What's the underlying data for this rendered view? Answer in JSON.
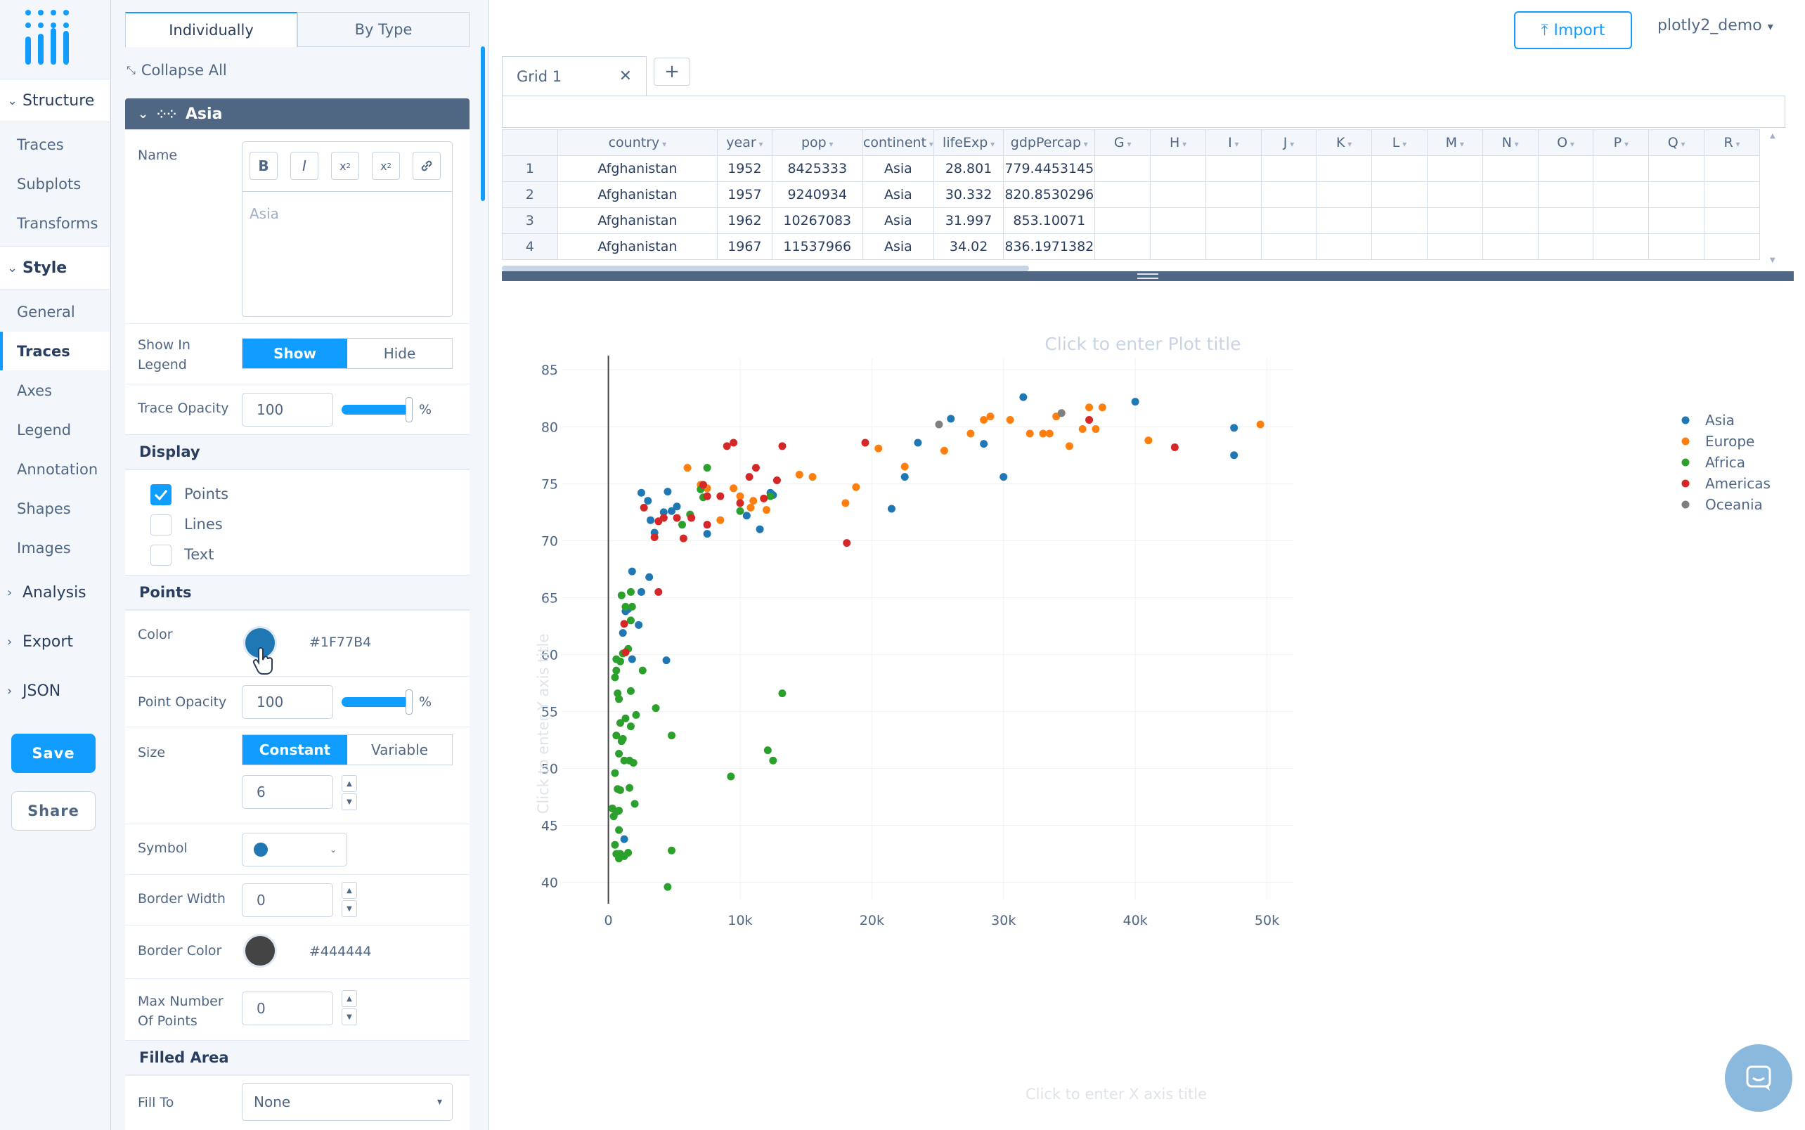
{
  "nav": {
    "sections": [
      {
        "label": "Structure",
        "items": [
          "Traces",
          "Subplots",
          "Transforms"
        ]
      },
      {
        "label": "Style",
        "items": [
          "General",
          "Traces",
          "Axes",
          "Legend",
          "Annotation",
          "Shapes",
          "Images"
        ]
      }
    ],
    "collapsed": [
      "Analysis",
      "Export",
      "JSON"
    ],
    "active_item": "Traces",
    "save_label": "Save",
    "share_label": "Share"
  },
  "panel": {
    "tabs": [
      "Individually",
      "By Type"
    ],
    "active_tab": "Individually",
    "collapse_all": "Collapse All",
    "trace_name": "Asia",
    "name_label": "Name",
    "name_value": "Asia",
    "format_buttons": [
      "B",
      "I",
      "x2",
      "x2",
      "link"
    ],
    "show_in_legend_label": "Show In Legend",
    "show_in_legend_options": [
      "Show",
      "Hide"
    ],
    "show_in_legend_selected": "Show",
    "trace_opacity_label": "Trace Opacity",
    "trace_opacity_value": "100",
    "percent": "%",
    "display_section": "Display",
    "display_options": [
      {
        "label": "Points",
        "checked": true
      },
      {
        "label": "Lines",
        "checked": false
      },
      {
        "label": "Text",
        "checked": false
      }
    ],
    "points_section": "Points",
    "color_label": "Color",
    "color_value": "#1F77B4",
    "point_opacity_label": "Point Opacity",
    "point_opacity_value": "100",
    "size_label": "Size",
    "size_options": [
      "Constant",
      "Variable"
    ],
    "size_selected": "Constant",
    "size_value": "6",
    "symbol_label": "Symbol",
    "border_width_label": "Border Width",
    "border_width_value": "0",
    "border_color_label": "Border Color",
    "border_color_value": "#444444",
    "max_points_label": "Max Number Of Points",
    "max_points_value": "0",
    "filled_area_section": "Filled Area",
    "fill_to_label": "Fill To",
    "fill_to_value": "None"
  },
  "header": {
    "import_label": "Import",
    "user_label": "plotly2_demo"
  },
  "grid": {
    "tab_label": "Grid 1",
    "add_label": "+",
    "columns": [
      "country",
      "year",
      "pop",
      "continent",
      "lifeExp",
      "gdpPercap",
      "G",
      "H",
      "I",
      "J",
      "K",
      "L",
      "M",
      "N",
      "O",
      "P",
      "Q",
      "R"
    ],
    "rows": [
      [
        "1",
        "Afghanistan",
        "1952",
        "8425333",
        "Asia",
        "28.801",
        "779.4453145"
      ],
      [
        "2",
        "Afghanistan",
        "1957",
        "9240934",
        "Asia",
        "30.332",
        "820.8530296"
      ],
      [
        "3",
        "Afghanistan",
        "1962",
        "10267083",
        "Asia",
        "31.997",
        "853.10071"
      ],
      [
        "4",
        "Afghanistan",
        "1967",
        "11537966",
        "Asia",
        "34.02",
        "836.1971382"
      ]
    ]
  },
  "chart_data": {
    "type": "scatter",
    "title": "Click to enter Plot title",
    "xlabel": "Click to enter X axis title",
    "ylabel": "Click to enter Y axis title",
    "xlim": [
      -3500,
      52000
    ],
    "ylim": [
      38.5,
      86
    ],
    "xticks": [
      0,
      10000,
      20000,
      30000,
      40000,
      50000
    ],
    "xtick_labels": [
      "0",
      "10k",
      "20k",
      "30k",
      "40k",
      "50k"
    ],
    "yticks": [
      40,
      45,
      50,
      55,
      60,
      65,
      70,
      75,
      80,
      85
    ],
    "legend_position": "top-right",
    "grid": true,
    "series": [
      {
        "name": "Asia",
        "color": "#1F77B4",
        "points": [
          [
            2500,
            74.2
          ],
          [
            3000,
            73.5
          ],
          [
            3200,
            71.8
          ],
          [
            3500,
            70.7
          ],
          [
            4200,
            72.5
          ],
          [
            4500,
            74.3
          ],
          [
            4800,
            72.6
          ],
          [
            5200,
            73.0
          ],
          [
            7500,
            70.6
          ],
          [
            10500,
            72.2
          ],
          [
            11500,
            71.0
          ],
          [
            12500,
            74.0
          ],
          [
            12300,
            74.2
          ],
          [
            21500,
            72.8
          ],
          [
            22500,
            75.6
          ],
          [
            23500,
            78.6
          ],
          [
            26000,
            80.7
          ],
          [
            28500,
            78.5
          ],
          [
            30000,
            75.6
          ],
          [
            31500,
            82.6
          ],
          [
            40000,
            82.2
          ],
          [
            47500,
            79.9
          ],
          [
            47500,
            77.5
          ],
          [
            1800,
            67.3
          ],
          [
            3100,
            66.8
          ],
          [
            2500,
            65.5
          ],
          [
            1500,
            64.0
          ],
          [
            1300,
            63.8
          ],
          [
            2300,
            62.6
          ],
          [
            1100,
            61.9
          ],
          [
            1800,
            59.6
          ],
          [
            4400,
            59.5
          ],
          [
            1200,
            43.8
          ]
        ]
      },
      {
        "name": "Europe",
        "color": "#FF7F0E",
        "points": [
          [
            6000,
            76.4
          ],
          [
            7000,
            74.9
          ],
          [
            7500,
            74.6
          ],
          [
            8500,
            71.8
          ],
          [
            9500,
            74.6
          ],
          [
            10000,
            73.9
          ],
          [
            10800,
            72.9
          ],
          [
            11000,
            73.5
          ],
          [
            12000,
            72.7
          ],
          [
            14500,
            75.8
          ],
          [
            15500,
            75.6
          ],
          [
            18000,
            73.3
          ],
          [
            18800,
            74.7
          ],
          [
            20500,
            78.1
          ],
          [
            22500,
            76.5
          ],
          [
            25500,
            77.9
          ],
          [
            27500,
            79.4
          ],
          [
            28500,
            80.6
          ],
          [
            29000,
            80.9
          ],
          [
            30500,
            80.6
          ],
          [
            32000,
            79.4
          ],
          [
            33000,
            79.4
          ],
          [
            33500,
            79.4
          ],
          [
            34000,
            80.9
          ],
          [
            35000,
            78.3
          ],
          [
            36000,
            79.8
          ],
          [
            36500,
            81.7
          ],
          [
            37000,
            79.8
          ],
          [
            37500,
            81.7
          ],
          [
            41000,
            78.8
          ],
          [
            49500,
            80.2
          ]
        ]
      },
      {
        "name": "Africa",
        "color": "#2CA02C",
        "points": [
          [
            600,
            42.5
          ],
          [
            800,
            42.1
          ],
          [
            900,
            42.5
          ],
          [
            1200,
            42.3
          ],
          [
            1500,
            42.6
          ],
          [
            500,
            43.3
          ],
          [
            800,
            44.6
          ],
          [
            400,
            45.8
          ],
          [
            600,
            46.2
          ],
          [
            800,
            46.3
          ],
          [
            300,
            46.5
          ],
          [
            2000,
            46.9
          ],
          [
            700,
            48.2
          ],
          [
            900,
            48.1
          ],
          [
            1600,
            48.3
          ],
          [
            500,
            49.6
          ],
          [
            1200,
            50.7
          ],
          [
            1600,
            50.7
          ],
          [
            1900,
            50.5
          ],
          [
            800,
            51.3
          ],
          [
            1000,
            52.4
          ],
          [
            1100,
            52.6
          ],
          [
            600,
            52.9
          ],
          [
            1700,
            53.7
          ],
          [
            900,
            54.0
          ],
          [
            1300,
            54.4
          ],
          [
            2100,
            54.7
          ],
          [
            800,
            56.1
          ],
          [
            700,
            56.6
          ],
          [
            1700,
            56.8
          ],
          [
            500,
            58.0
          ],
          [
            600,
            58.6
          ],
          [
            2600,
            58.6
          ],
          [
            900,
            59.4
          ],
          [
            600,
            59.6
          ],
          [
            1100,
            60.1
          ],
          [
            1500,
            60.5
          ],
          [
            1700,
            63.0
          ],
          [
            1300,
            64.2
          ],
          [
            1800,
            64.2
          ],
          [
            1700,
            65.5
          ],
          [
            1000,
            65.2
          ],
          [
            3600,
            55.3
          ],
          [
            4800,
            52.9
          ],
          [
            4800,
            42.8
          ],
          [
            4500,
            39.6
          ],
          [
            9300,
            49.3
          ],
          [
            12100,
            51.6
          ],
          [
            12500,
            50.7
          ],
          [
            13200,
            56.6
          ],
          [
            5600,
            71.4
          ],
          [
            6200,
            72.3
          ],
          [
            7000,
            74.5
          ],
          [
            7200,
            73.8
          ],
          [
            7500,
            76.4
          ],
          [
            12300,
            73.9
          ],
          [
            10000,
            72.6
          ]
        ]
      },
      {
        "name": "Americas",
        "color": "#D62728",
        "points": [
          [
            2700,
            72.9
          ],
          [
            3500,
            70.3
          ],
          [
            3800,
            71.7
          ],
          [
            4200,
            72.0
          ],
          [
            5200,
            72.0
          ],
          [
            5700,
            70.2
          ],
          [
            6300,
            72.0
          ],
          [
            7200,
            74.9
          ],
          [
            7500,
            71.4
          ],
          [
            7500,
            73.9
          ],
          [
            8500,
            73.9
          ],
          [
            9000,
            78.3
          ],
          [
            9500,
            78.6
          ],
          [
            10000,
            73.3
          ],
          [
            10700,
            75.6
          ],
          [
            11200,
            76.4
          ],
          [
            11800,
            73.7
          ],
          [
            12800,
            75.3
          ],
          [
            13200,
            78.3
          ],
          [
            18100,
            69.8
          ],
          [
            19500,
            78.6
          ],
          [
            36500,
            80.6
          ],
          [
            43000,
            78.2
          ],
          [
            3800,
            65.5
          ],
          [
            1200,
            62.7
          ],
          [
            1300,
            60.2
          ]
        ]
      },
      {
        "name": "Oceania",
        "color": "#7F7F7F",
        "points": [
          [
            25100,
            80.2
          ],
          [
            34400,
            81.2
          ]
        ]
      }
    ]
  }
}
